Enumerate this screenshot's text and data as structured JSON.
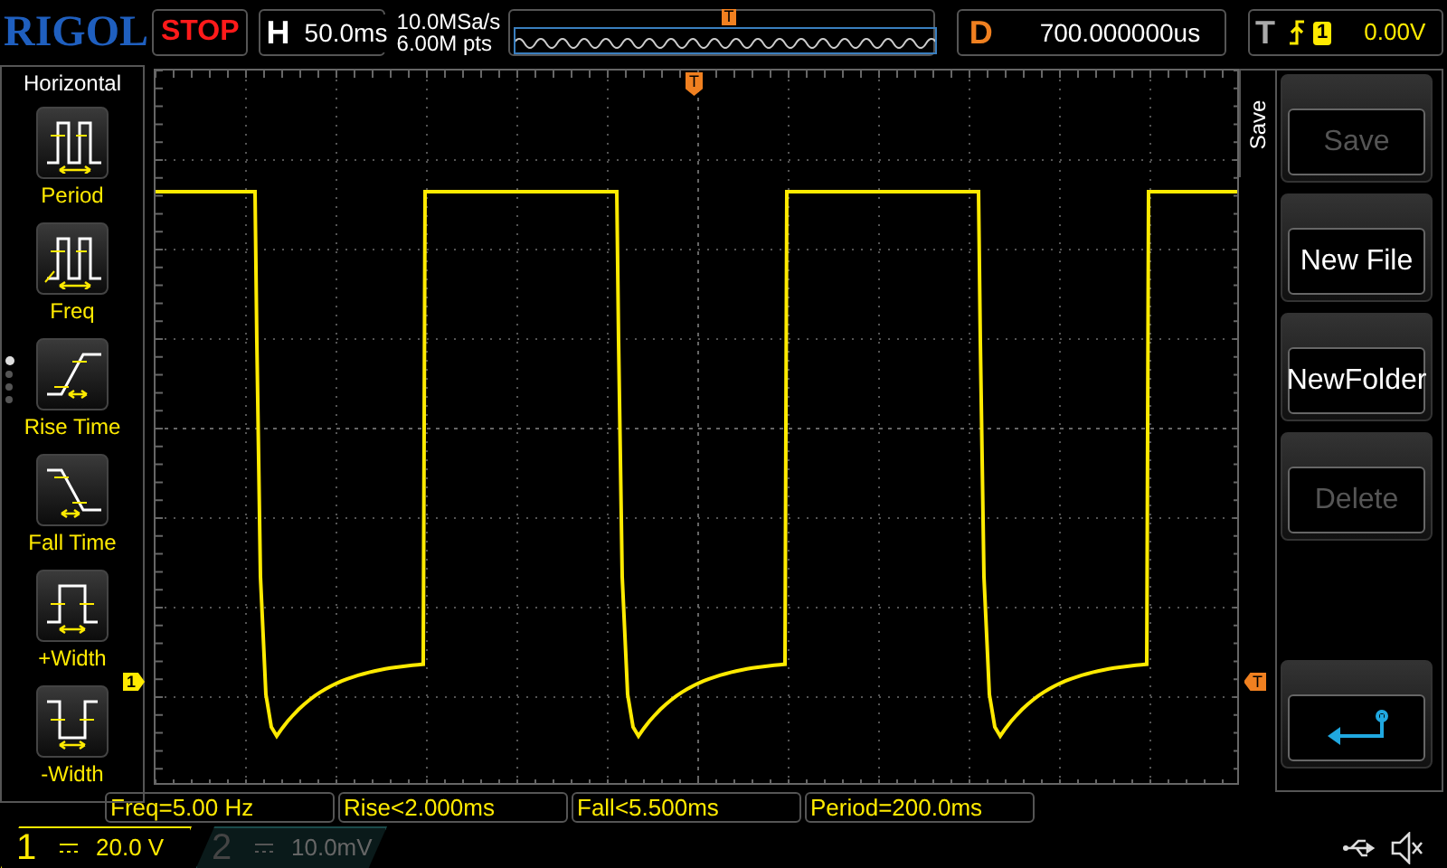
{
  "top_bar": {
    "brand": "RIGOL",
    "run_state": "STOP",
    "timebase": {
      "label": "H",
      "value": "50.0ms"
    },
    "sample_rate": "10.0MSa/s",
    "memory_depth": "6.00M pts",
    "overview_marker": "T",
    "delay": {
      "label": "D",
      "value": "700.000000us"
    },
    "trigger": {
      "label": "T",
      "source": "1",
      "level": "0.00V"
    }
  },
  "left_menu": {
    "title": "Horizontal",
    "pages": [
      {
        "selected": true
      },
      {
        "selected": false
      },
      {
        "selected": false
      },
      {
        "selected": false
      }
    ],
    "items": [
      {
        "kind": "period",
        "label": "Period"
      },
      {
        "kind": "freq",
        "label": "Freq"
      },
      {
        "kind": "rise",
        "label": "Rise Time"
      },
      {
        "kind": "fall",
        "label": "Fall Time"
      },
      {
        "kind": "pwidth",
        "label": "+Width"
      },
      {
        "kind": "nwidth",
        "label": "-Width"
      }
    ]
  },
  "screen": {
    "channel_marker": "1",
    "trigger_marker": "T",
    "trigger_position_marker": "T"
  },
  "right_menu": {
    "title": "Save",
    "buttons": [
      {
        "kind": "text",
        "label": "Save",
        "disabled": true
      },
      {
        "kind": "text",
        "label": "New File",
        "disabled": false
      },
      {
        "kind": "text",
        "label": "NewFolder",
        "disabled": false
      },
      {
        "kind": "text",
        "label": "Delete",
        "disabled": true
      },
      {
        "kind": "spacer"
      },
      {
        "kind": "back"
      }
    ]
  },
  "measurements": [
    "Freq=5.00 Hz",
    "Rise<2.000ms",
    "Fall<5.500ms",
    "Period=200.0ms"
  ],
  "channels": [
    {
      "label": "1",
      "scale": "20.0 V",
      "active": true
    },
    {
      "label": "2",
      "scale": "10.0mV",
      "active": false
    }
  ]
}
